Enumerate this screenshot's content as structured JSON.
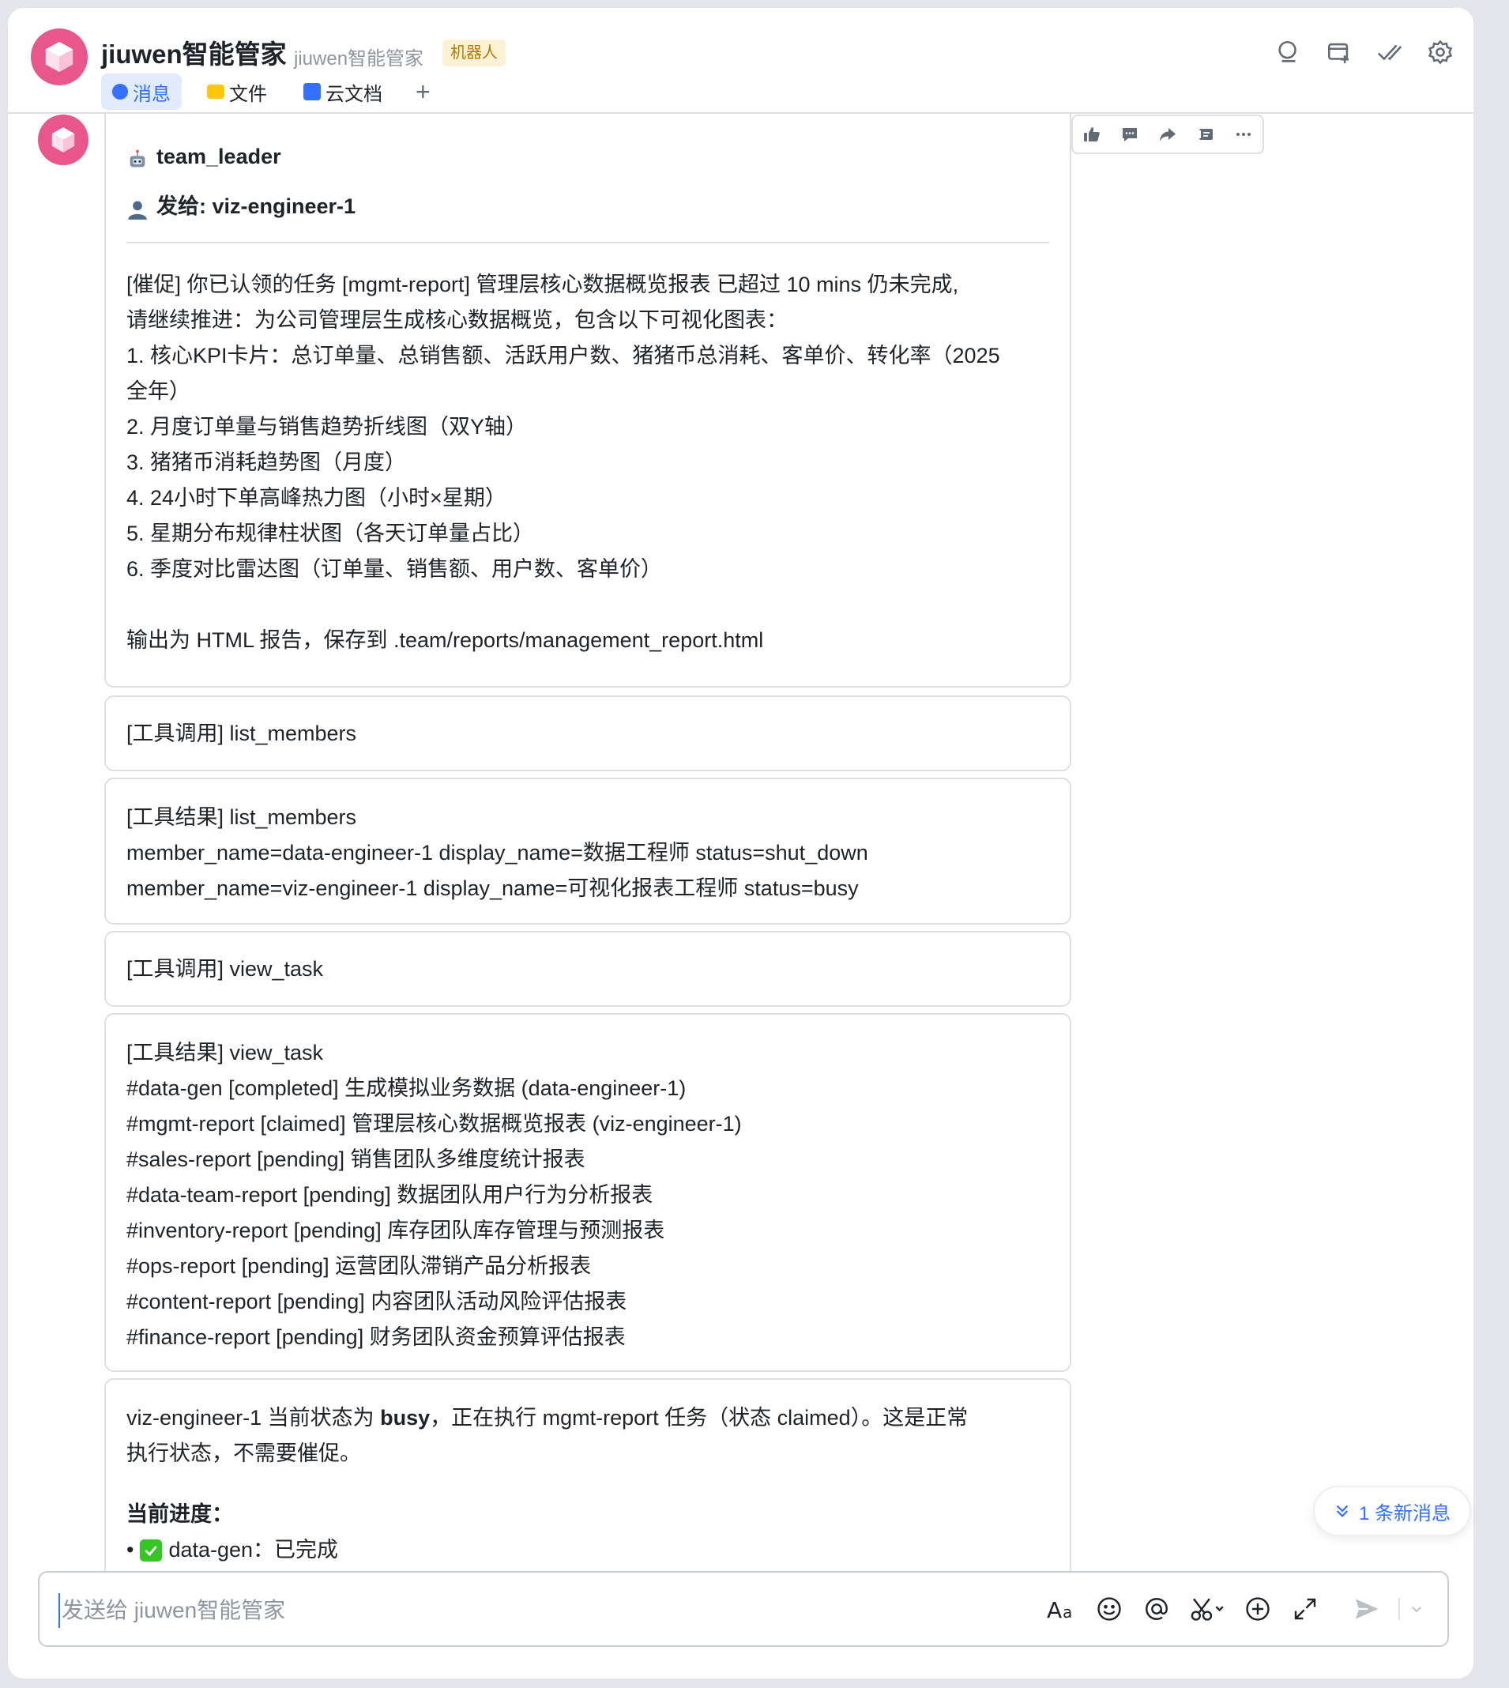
{
  "header": {
    "title": "jiuwen智能管家",
    "subtitle": "jiuwen智能管家",
    "badge": "机器人",
    "tabs": [
      {
        "label": "消息",
        "active": true,
        "icon": "message-bubble-icon"
      },
      {
        "label": "文件",
        "active": false,
        "icon": "folder-icon"
      },
      {
        "label": "云文档",
        "active": false,
        "icon": "cloud-doc-icon"
      }
    ],
    "add_tab": "+",
    "icons": [
      "search-icon",
      "add-chat-icon",
      "double-check-icon",
      "gear-icon"
    ]
  },
  "message": {
    "sender": "team_leader",
    "recipient": "发给: viz-engineer-1",
    "lines": [
      "[催促] 你已认领的任务 [mgmt-report] 管理层核心数据概览报表 已超过 10 mins 仍未完成,",
      "请继续推进：为公司管理层生成核心数据概览，包含以下可视化图表：",
      "1. 核心KPI卡片：总订单量、总销售额、活跃用户数、猪猪币总消耗、客单价、转化率（2025",
      "全年）",
      "2. 月度订单量与销售趋势折线图（双Y轴）",
      "3. 猪猪币消耗趋势图（月度）",
      "4. 24小时下单高峰热力图（小时×星期）",
      "5. 星期分布规律柱状图（各天订单量占比）",
      "6. 季度对比雷达图（订单量、销售额、用户数、客单价）",
      "",
      "输出为 HTML 报告，保存到 .team/reports/management_report.html"
    ]
  },
  "tool_call_1": "[工具调用] list_members",
  "tool_result_1": [
    "[工具结果] list_members",
    "member_name=data-engineer-1 display_name=数据工程师 status=shut_down",
    "member_name=viz-engineer-1 display_name=可视化报表工程师 status=busy"
  ],
  "tool_call_2": "[工具调用] view_task",
  "tool_result_2": [
    "[工具结果] view_task",
    "#data-gen [completed] 生成模拟业务数据 (data-engineer-1)",
    "#mgmt-report [claimed] 管理层核心数据概览报表 (viz-engineer-1)",
    "#sales-report [pending] 销售团队多维度统计报表",
    "#data-team-report [pending] 数据团队用户行为分析报表",
    "#inventory-report [pending] 库存团队库存管理与预测报表",
    "#ops-report [pending] 运营团队滞销产品分析报表",
    "#content-report [pending] 内容团队活动风险评估报表",
    "#finance-report [pending] 财务团队资金预算评估报表"
  ],
  "reply": {
    "line1_a": "viz-engineer-1 当前状态为 ",
    "line1_b": "busy",
    "line1_c": "，正在执行 mgmt-report 任务（状态 claimed）。这是正常",
    "line2": "执行状态，不需要催促。",
    "progress_title": "当前进度：",
    "progress_bullet": "•",
    "progress_item": "data-gen：已完成"
  },
  "actions": [
    "thumbs-up-icon",
    "comment-icon",
    "forward-icon",
    "pin-icon",
    "more-icon"
  ],
  "new_messages": "1 条新消息",
  "composer": {
    "placeholder": "发送给 jiuwen智能管家"
  },
  "colors": {
    "accent": "#3370ff",
    "avatar": "#e8568a",
    "badge_bg": "#fcf1d5",
    "badge_text": "#b37a00",
    "check_green": "#34c724"
  }
}
